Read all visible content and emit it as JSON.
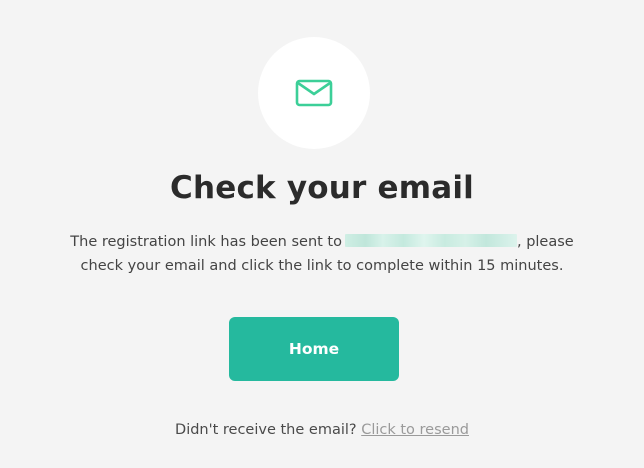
{
  "icon": {
    "name": "mail-icon",
    "color": "#3ccf98"
  },
  "title": "Check your email",
  "message": {
    "line1_prefix": "The registration link has been sent to",
    "line1_suffix": ", please",
    "line2": "check your email and click the link to complete within 15 minutes."
  },
  "button": {
    "label": "Home",
    "color": "#25b99e"
  },
  "resend": {
    "prompt": "Didn't receive the email?",
    "link_label": "Click to resend"
  },
  "colors": {
    "background": "#f4f4f4",
    "accent": "#25b99e",
    "link": "#9a9a9a"
  }
}
